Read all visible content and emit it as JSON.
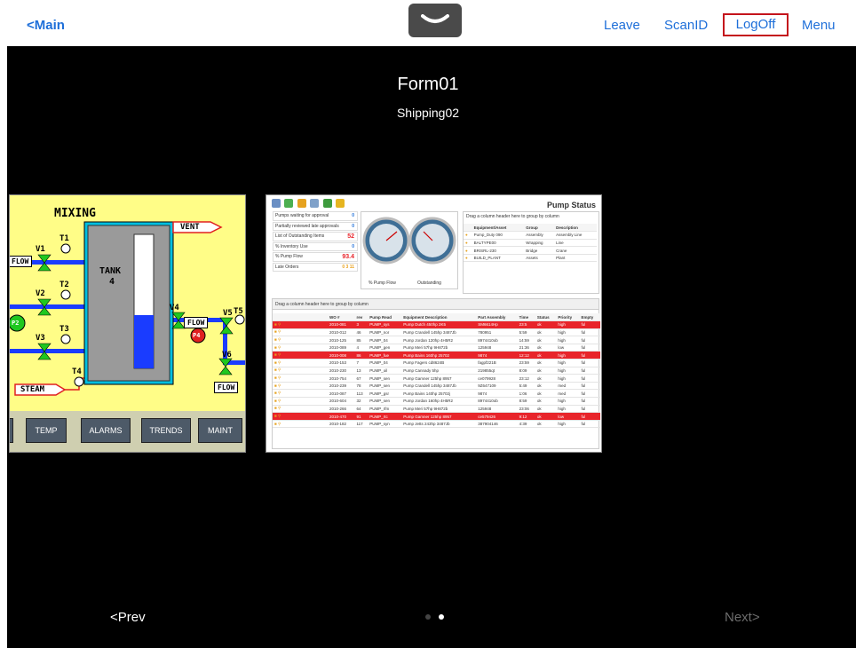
{
  "nav": {
    "back_label": "<Main",
    "leave_label": "Leave",
    "scan_label": "ScanID",
    "logoff_label": "LogOff",
    "menu_label": "Menu",
    "handle_icon": "chevron-down-icon"
  },
  "form": {
    "title": "Form01",
    "subtitle": "Shipping02"
  },
  "mixing": {
    "title": "MIXING",
    "vent": "VENT",
    "tank": [
      "TANK",
      "4"
    ],
    "valves": [
      "V1",
      "V2",
      "V3",
      "V4",
      "V5",
      "V6"
    ],
    "temps": [
      "T1",
      "T2",
      "T3",
      "T4",
      "T5"
    ],
    "pumps": [
      "P2",
      "P4"
    ],
    "flow_labels": [
      "FLOW",
      "FLOW",
      "FLOW"
    ],
    "steam": "STEAM",
    "buttons": [
      "S",
      "TEMP",
      "ALARMS",
      "TRENDS",
      "MAINT"
    ]
  },
  "pump": {
    "title": "Pump Status",
    "kpis": [
      {
        "label": "Pumps waiting for approval",
        "value": "0"
      },
      {
        "label": "Partially reviewed late approvals",
        "value": "0"
      },
      {
        "label": "List of Outstanding Items",
        "value": "52"
      },
      {
        "label": "% Inventory Use",
        "value": "0"
      },
      {
        "label": "% Pump Flow",
        "value": "93.4"
      },
      {
        "label": "Late Orders",
        "value": "0 3 11"
      }
    ],
    "gauge_labels": [
      "% Pump Flow",
      "Outstanding"
    ],
    "group_hint": "Drag a column header here to group by column",
    "eq_columns": [
      "Equipment/Asset",
      "Group",
      "Description"
    ],
    "eq_rows": [
      [
        "Pump_Duty 090",
        "Assembly",
        "Assembly Line"
      ],
      [
        "BALTYPE00",
        "Wrapping",
        "Line"
      ],
      [
        "BRISRL-230",
        "Bridge",
        "Crane"
      ],
      [
        "BUILD_PLANT",
        "Assets",
        "Plant"
      ]
    ],
    "columns": [
      "WO #",
      "rev",
      "Pump Read",
      "Equipment Description",
      "Part Assembly",
      "Time",
      "Status",
      "Priority",
      "Empty"
    ],
    "rows": [
      {
        "cells": [
          "2010-081",
          "3",
          "PUMP_sys",
          "Pump Dutch 450hp 2K5",
          "SM6614Hp",
          "23:5",
          "ok",
          "high",
          "ful"
        ],
        "alert": true
      },
      {
        "cells": [
          "2010-012",
          "46",
          "PUMP_nor",
          "Pump Crandell 145hp 3487Jb",
          "780951",
          "5:59",
          "ok",
          "high",
          "ful"
        ],
        "alert": false
      },
      {
        "cells": [
          "2010-125",
          "85",
          "PUMP_04",
          "Pump Jordan 120hp 4H5R2",
          "8974410ob",
          "14:59",
          "ok",
          "high",
          "ful"
        ],
        "alert": false
      },
      {
        "cells": [
          "2010-089",
          "4",
          "PUMP_gen",
          "Pump Meri 57hp 9H872b",
          "125948",
          "21:36",
          "ok",
          "low",
          "ful"
        ],
        "alert": false
      },
      {
        "cells": [
          "2010-008",
          "86",
          "PUMP_fue",
          "Pump Bains 160hp 25702",
          "9874",
          "12:12",
          "ok",
          "high",
          "ful"
        ],
        "alert": true
      },
      {
        "cells": [
          "2010-153",
          "7",
          "PUMP_04",
          "Pump Fagers cd8624B",
          "fagpf221B",
          "23:59",
          "ok",
          "high",
          "ful"
        ],
        "alert": false
      },
      {
        "cells": [
          "2010-230",
          "13",
          "PUMP_oil",
          "Pump Cannady 5hp",
          "219855qt",
          "8:09",
          "ok",
          "high",
          "ful"
        ],
        "alert": false
      },
      {
        "cells": [
          "2010-754",
          "67",
          "PUMP_sen",
          "Pump Gamner 125hp 8957",
          "ce079928",
          "23:12",
          "ok",
          "high",
          "ful"
        ],
        "alert": false
      },
      {
        "cells": [
          "2010-239",
          "78",
          "PUMP_sen",
          "Pump Crandell 145hp 3487Jb",
          "9Z647109",
          "5:49",
          "ok",
          "med",
          "ful"
        ],
        "alert": false
      },
      {
        "cells": [
          "2010-087",
          "113",
          "PUMP_gsr",
          "Pump Bains 140hp 25702j",
          "9874",
          "1:06",
          "ok",
          "med",
          "ful"
        ],
        "alert": false
      },
      {
        "cells": [
          "2010-604",
          "32",
          "PUMP_sen",
          "Pump Jordan 160hp 4H5R2",
          "8974410ob",
          "8:59",
          "ok",
          "high",
          "ful"
        ],
        "alert": false
      },
      {
        "cells": [
          "2010-266",
          "64",
          "PUMP_rfm",
          "Pump Meri 57hp 9H872b",
          "125948",
          "23:06",
          "ok",
          "high",
          "ful"
        ],
        "alert": false
      },
      {
        "cells": [
          "2010-470",
          "91",
          "PUMP_rtc",
          "Pump Gamner 125hp 8957",
          "ce579426",
          "9:12",
          "ok",
          "low",
          "ful"
        ],
        "alert": true
      },
      {
        "cells": [
          "2010-182",
          "117",
          "PUMP_syn",
          "Pump Jetts 243hp 3487Jb",
          "387904146",
          "4:39",
          "ok",
          "high",
          "ful"
        ],
        "alert": false
      }
    ]
  },
  "footer": {
    "prev_label": "<Prev",
    "next_label": "Next>",
    "page_current": 2,
    "page_count": 2
  },
  "colors": {
    "link": "#1e6fd9",
    "logoff_border": "#c4131c",
    "stage": "#000000",
    "mix_bg": "#fffd87",
    "pipe": "#1a3cff",
    "valve": "#1fc71f",
    "alert_row": "#e8242a"
  }
}
